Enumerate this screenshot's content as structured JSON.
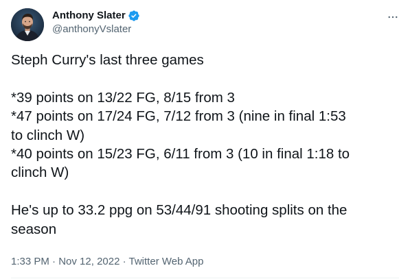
{
  "author": {
    "display_name": "Anthony Slater",
    "handle": "@anthonyVslater",
    "verified": true,
    "avatar_icon": "profile-photo"
  },
  "tweet": {
    "line1": "Steph Curry's last three games",
    "line2": "*39 points on 13/22 FG, 8/15 from 3",
    "line3": "*47 points on 17/24 FG, 7/12 from 3 (nine in final 1:53",
    "line4": "to clinch W)",
    "line5": "*40 points on 15/23 FG, 6/11 from 3 (10 in final 1:18 to",
    "line6": "clinch W)",
    "line7": "He's up to 33.2 ppg on 53/44/91 shooting splits on the",
    "line8": "season"
  },
  "meta": {
    "time": "1:33 PM",
    "separator": " · ",
    "date": "Nov 12, 2022",
    "source": "Twitter Web App"
  },
  "icons": {
    "verified_badge": "verified-badge-icon",
    "more": "more-options-icon"
  },
  "colors": {
    "verified": "#1d9bf0",
    "secondary_text": "#536471",
    "primary_text": "#0f1419"
  }
}
